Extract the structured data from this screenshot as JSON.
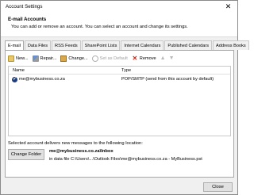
{
  "window": {
    "title": "Account Settings",
    "close_glyph": "✕"
  },
  "header": {
    "title": "E-mail Accounts",
    "subtitle": "You can add or remove an account. You can select an account and change its settings."
  },
  "tabs": [
    {
      "label": "E-mail",
      "active": true
    },
    {
      "label": "Data Files"
    },
    {
      "label": "RSS Feeds"
    },
    {
      "label": "SharePoint Lists"
    },
    {
      "label": "Internet Calendars"
    },
    {
      "label": "Published Calendars"
    },
    {
      "label": "Address Books"
    }
  ],
  "toolbar": {
    "new_label": "New...",
    "repair_label": "Repair...",
    "change_label": "Change...",
    "set_default_label": "Set as Default",
    "remove_label": "Remove",
    "remove_glyph": "✕",
    "up_glyph": "▲",
    "down_glyph": "▼"
  },
  "accounts_list": {
    "columns": {
      "name": "Name",
      "type": "Type"
    },
    "rows": [
      {
        "name": "me@mybusiness.co.za",
        "type": "POP/SMTP (send from this account by default)",
        "default": true,
        "check_glyph": "✔"
      }
    ]
  },
  "delivery": {
    "text": "Selected account delivers new messages to the following location:",
    "change_folder_label": "Change Folder",
    "folder": "me@mybusiness.co.za\\Inbox",
    "path": "in data file C:\\Users\\...\\Outlook Files\\me@mybusiness.co.za - MyBusiness.pst"
  },
  "footer": {
    "close_label": "Close"
  }
}
